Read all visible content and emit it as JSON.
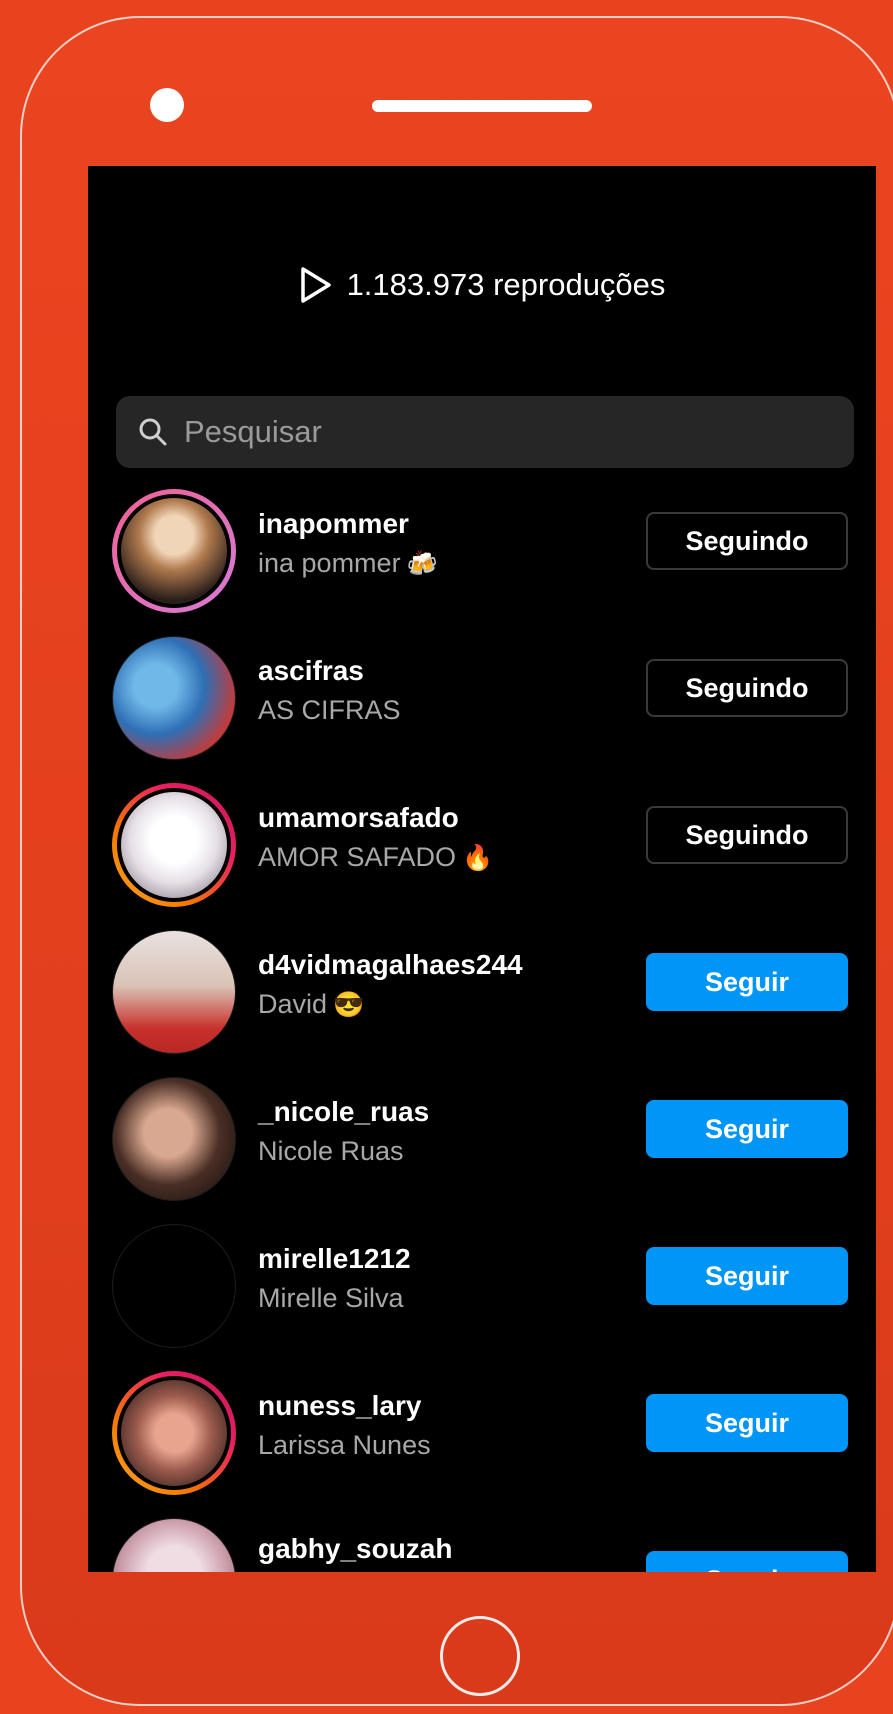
{
  "header": {
    "plays_text": "1.183.973 reproduções"
  },
  "search": {
    "placeholder": "Pesquisar"
  },
  "colors": {
    "background_frame": "#e8431f",
    "follow_button": "#0095f6",
    "screen": "#000000"
  },
  "users": [
    {
      "username": "inapommer",
      "fullname": "ina pommer",
      "emoji": "🍻",
      "button": "Seguindo",
      "state": "following",
      "avatar_color": "#c9a27a"
    },
    {
      "username": "ascifras",
      "fullname": "AS CIFRAS",
      "emoji": "",
      "button": "Seguindo",
      "state": "following",
      "avatar_color": "#3d6fb0"
    },
    {
      "username": "umamorsafado",
      "fullname": "AMOR SAFADO",
      "emoji": "🔥",
      "button": "Seguindo",
      "state": "following",
      "avatar_color": "#e9e4ea"
    },
    {
      "username": "d4vidmagalhaes244",
      "fullname": "David",
      "emoji": "😎",
      "button": "Seguir",
      "state": "follow",
      "avatar_color": "#d8c4bc"
    },
    {
      "username": "_nicole_ruas",
      "fullname": "Nicole Ruas",
      "emoji": "",
      "button": "Seguir",
      "state": "follow",
      "avatar_color": "#6b4a3e"
    },
    {
      "username": "mirelle1212",
      "fullname": "Mirelle Silva",
      "emoji": "",
      "button": "Seguir",
      "state": "follow",
      "avatar_color": "#000000"
    },
    {
      "username": "nuness_lary",
      "fullname": "Larissa Nunes",
      "emoji": "",
      "button": "Seguir",
      "state": "follow",
      "avatar_color": "#b37a6c"
    },
    {
      "username": "gabhy_souzah",
      "fullname": "",
      "emoji": "",
      "button": "Seguir",
      "state": "follow",
      "avatar_color": "#e8d6de"
    }
  ]
}
